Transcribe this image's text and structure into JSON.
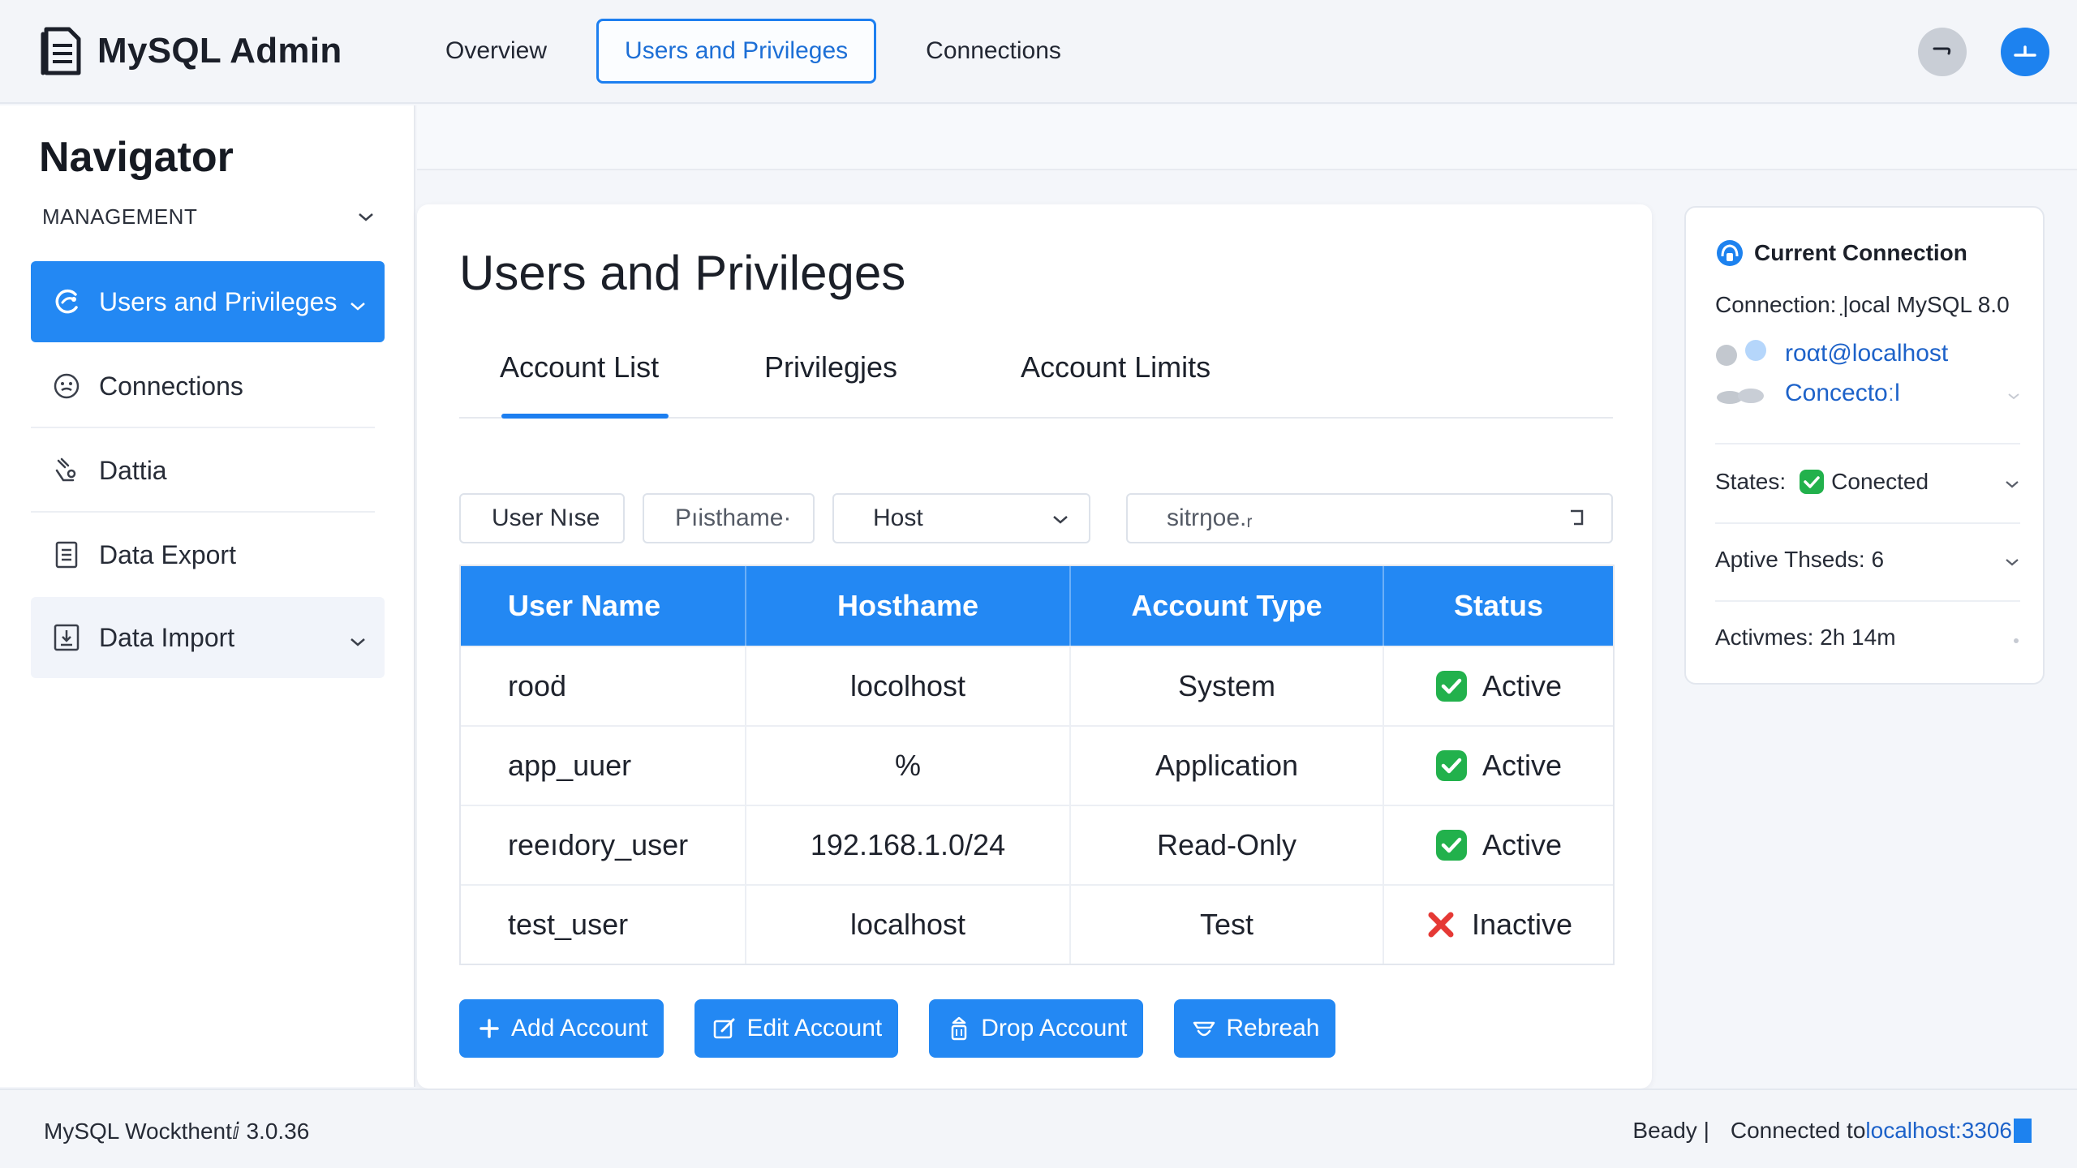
{
  "app": {
    "title": "MySQL Admin",
    "brand_icon": "document-icon"
  },
  "topnav": {
    "items": [
      {
        "label": "Overview",
        "active": false
      },
      {
        "label": "Users and Privileges",
        "active": true
      },
      {
        "label": "Connections",
        "active": false
      }
    ]
  },
  "sidebar": {
    "title": "Navigator",
    "section": "MANAGEMENT",
    "items": [
      {
        "label": "Users and Privileges",
        "icon": "users-icon",
        "active": true
      },
      {
        "label": "Connections",
        "icon": "connections-icon"
      },
      {
        "label": "Dattia",
        "icon": "data-icon"
      },
      {
        "label": "Data Export",
        "icon": "export-icon"
      },
      {
        "label": "Data Import",
        "icon": "import-icon"
      }
    ]
  },
  "main": {
    "title": "Users and Privileges",
    "tabs": [
      "Account List",
      "Privilegjes",
      "Account Limits"
    ],
    "filters": {
      "user": "User Nıse",
      "hostname": "Pıisthame·",
      "host": "Host",
      "search": "sitrŋoe.ᵣ"
    },
    "table": {
      "headers": [
        "User Name",
        "Hosthame",
        "Account Type",
        "Status"
      ],
      "rows": [
        {
          "user": "rooḋ",
          "host": "locolhost",
          "type": "System",
          "status": "Active",
          "ok": true
        },
        {
          "user": "app_uuer",
          "host": "%",
          "type": "Application",
          "status": "Active",
          "ok": true
        },
        {
          "user": "reeıdory_user",
          "host": "192.168.1.0/24",
          "type": "Read-Only",
          "status": "Active",
          "ok": true
        },
        {
          "user": "test_user",
          "host": "localhost",
          "type": "Test",
          "status": "Inactive",
          "ok": false
        }
      ]
    },
    "buttons": {
      "add": "Add Account",
      "edit": "Edit Account",
      "drop": "Drop Account",
      "refresh": "Rebreah"
    }
  },
  "panel": {
    "title": "Current Connection",
    "connection": "Connection: |̣ocal MySQL 8.0",
    "user": "roαt@localhost",
    "connector": "Concectoːl",
    "states_label": "States:",
    "states_value": "Conected",
    "threads": "Aptive Thseds: 6",
    "time": "Activmes: 2h 14m"
  },
  "statusbar": {
    "version": "MySQL Wockthentⅈ 3.0.36",
    "ready": "Beady |",
    "connected_prefix": "Connected to ",
    "connected_host": "localhost:3306"
  },
  "colors": {
    "accent": "#2388f3",
    "success": "#22b14c",
    "error": "#e53935"
  }
}
